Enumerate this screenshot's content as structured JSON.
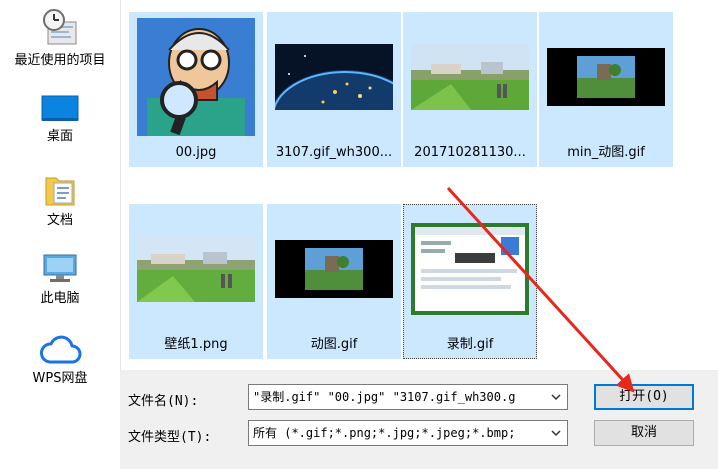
{
  "sidebar": {
    "items": [
      {
        "label": "最近使用的项目",
        "icon": "recent-clock-icon"
      },
      {
        "label": "桌面",
        "icon": "desktop-icon"
      },
      {
        "label": "文档",
        "icon": "documents-folder-icon"
      },
      {
        "label": "此电脑",
        "icon": "this-pc-icon"
      },
      {
        "label": "WPS网盘",
        "icon": "wps-cloud-icon"
      }
    ]
  },
  "files": [
    {
      "name": "00.jpg",
      "thumb": "cartoon-man-magnifier"
    },
    {
      "name": "3107.gif_wh300...",
      "thumb": "earth-at-night"
    },
    {
      "name": "201710281130...",
      "thumb": "green-field"
    },
    {
      "name": "min_动图.gif",
      "thumb": "dark-landscape"
    },
    {
      "name": "壁纸1.png",
      "thumb": "green-field"
    },
    {
      "name": "动图.gif",
      "thumb": "dark-landscape"
    },
    {
      "name": "录制.gif",
      "thumb": "screen-capture"
    }
  ],
  "filename": {
    "label": "文件名(N):",
    "value": "\"录制.gif\" \"00.jpg\" \"3107.gif_wh300.g"
  },
  "filetype": {
    "label": "文件类型(T):",
    "value": "所有 (*.gif;*.png;*.jpg;*.jpeg;*.bmp;"
  },
  "buttons": {
    "open": "打开(O)",
    "cancel": "取消"
  },
  "colors": {
    "selection": "#cce8ff",
    "arrow": "#e8261c",
    "accent": "#0078d7"
  }
}
